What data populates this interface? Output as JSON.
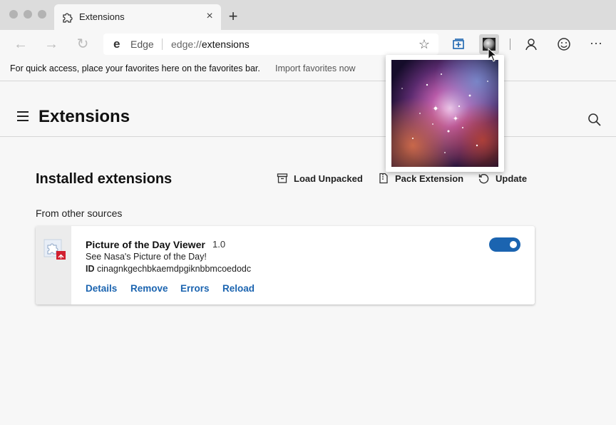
{
  "tab": {
    "title": "Extensions",
    "close": "×",
    "new_tab": "+"
  },
  "toolbar": {
    "back": "←",
    "forward": "→",
    "refresh": "↻",
    "brand": "Edge",
    "url_prefix": "edge://",
    "url_path": "extensions",
    "favorite_star": "☆",
    "more": "···"
  },
  "favorites_bar": {
    "message": "For quick access, place your favorites here on the favorites bar.",
    "import_link": "Import favorites now"
  },
  "header": {
    "title": "Extensions"
  },
  "installed": {
    "title": "Installed extensions",
    "load_unpacked": "Load Unpacked",
    "pack_extension": "Pack Extension",
    "update": "Update",
    "from_other_sources": "From other sources"
  },
  "extension": {
    "name": "Picture of the Day Viewer",
    "version": "1.0",
    "description": "See Nasa's Picture of the Day!",
    "id_label": "ID",
    "id_value": "cinagnkgechbkaemdpgiknbbmcoedodc",
    "enabled": true,
    "links": {
      "details": "Details",
      "remove": "Remove",
      "errors": "Errors",
      "reload": "Reload"
    }
  },
  "colors": {
    "accent": "#1b64b0",
    "tab_strip": "#dcdcdc",
    "page_bg": "#f7f7f7"
  }
}
